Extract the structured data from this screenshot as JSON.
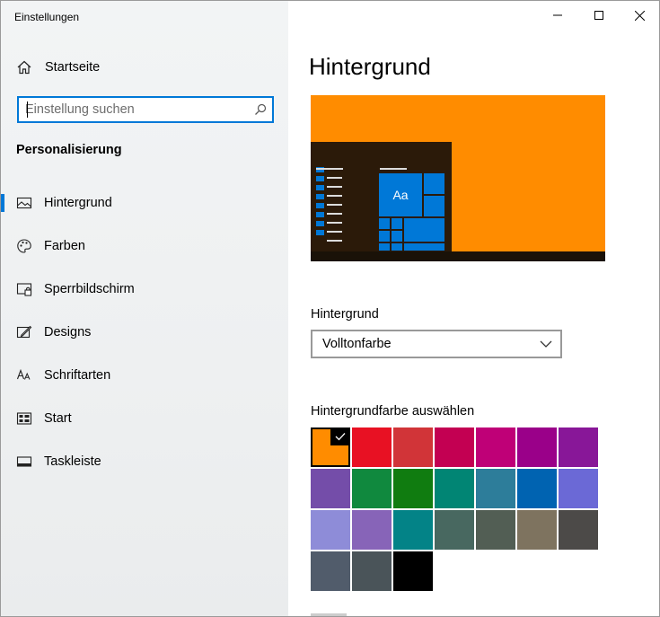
{
  "window": {
    "title": "Einstellungen",
    "controls": {
      "minimize": "minimize-icon",
      "maximize": "maximize-icon",
      "close": "close-icon"
    }
  },
  "sidebar": {
    "home_label": "Startseite",
    "search": {
      "placeholder": "Einstellung suchen",
      "value": ""
    },
    "section_title": "Personalisierung",
    "items": [
      {
        "label": "Hintergrund",
        "icon": "picture-icon",
        "active": true
      },
      {
        "label": "Farben",
        "icon": "palette-icon"
      },
      {
        "label": "Sperrbildschirm",
        "icon": "lockscreen-icon"
      },
      {
        "label": "Designs",
        "icon": "designs-icon"
      },
      {
        "label": "Schriftarten",
        "icon": "fonts-icon"
      },
      {
        "label": "Start",
        "icon": "start-icon"
      },
      {
        "label": "Taskleiste",
        "icon": "taskbar-icon"
      }
    ]
  },
  "main": {
    "title": "Hintergrund",
    "preview": {
      "accent": "#ff8c00",
      "tile_text": "Aa"
    },
    "background_label": "Hintergrund",
    "background_select": {
      "value": "Volltonfarbe"
    },
    "color_label": "Hintergrundfarbe auswählen",
    "colors": [
      "#ff8c00",
      "#e81123",
      "#d13438",
      "#c30052",
      "#bf0077",
      "#9a0089",
      "#881798",
      "#744da9",
      "#10893e",
      "#107c10",
      "#018574",
      "#2d7d9a",
      "#0063b1",
      "#6b69d6",
      "#8e8cd8",
      "#8764b8",
      "#038387",
      "#486860",
      "#525e54",
      "#7e735f",
      "#4c4a48",
      "#515c6b",
      "#4a5459",
      "#000000"
    ],
    "selected_color_index": 0
  }
}
